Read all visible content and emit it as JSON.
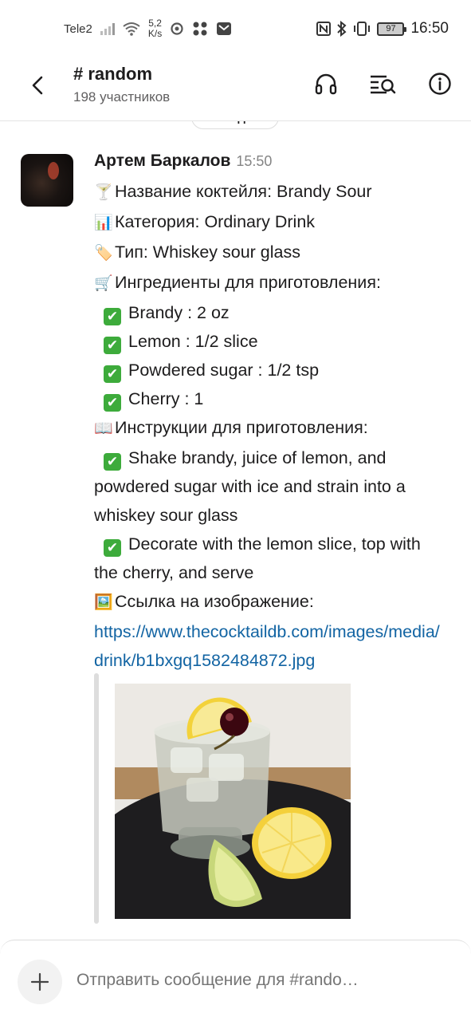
{
  "status_bar": {
    "carrier": "Tele2",
    "speed_value": "5,2",
    "speed_unit": "K/s",
    "battery": "97",
    "time": "16:50"
  },
  "header": {
    "title": "# random",
    "subtitle": "198 участников",
    "icons": [
      "back-arrow-icon",
      "headphones-icon",
      "search-list-icon",
      "info-icon"
    ]
  },
  "date_divider": "Сегодня",
  "message": {
    "author": "Артем Баркалов",
    "time": "15:50",
    "lines": {
      "name": "Название коктейля: Brandy Sour",
      "category": "Категория: Ordinary Drink",
      "type": "Тип: Whiskey sour glass",
      "ingredients_title": "Ингредиенты для приготовления:",
      "ingredients": [
        "Brandy : 2 oz",
        "Lemon : 1/2 slice",
        "Powdered sugar : 1/2 tsp",
        "Cherry : 1"
      ],
      "instructions_title": "Инструкции для приготовления:",
      "instructions": [
        "Shake brandy, juice of lemon, and powdered sugar with ice and strain into a whiskey sour glass",
        "Decorate with the lemon slice, top with the cherry, and serve"
      ],
      "image_title": "Ссылка на изображение:",
      "link": "https://www.thecocktaildb.com/images/media/drink/b1bxgq1582484872.jpg"
    },
    "emojis": {
      "name": "🍸",
      "category": "📊",
      "type": "🏷️",
      "ingredients": "🛒",
      "instructions": "📖",
      "image": "🖼️",
      "check": "✔"
    }
  },
  "composer": {
    "placeholder": "Отправить сообщение для #rando…"
  },
  "colors": {
    "link": "#1264a3",
    "check": "#3dab3b",
    "text": "#1d1c1d",
    "muted": "#616061"
  }
}
